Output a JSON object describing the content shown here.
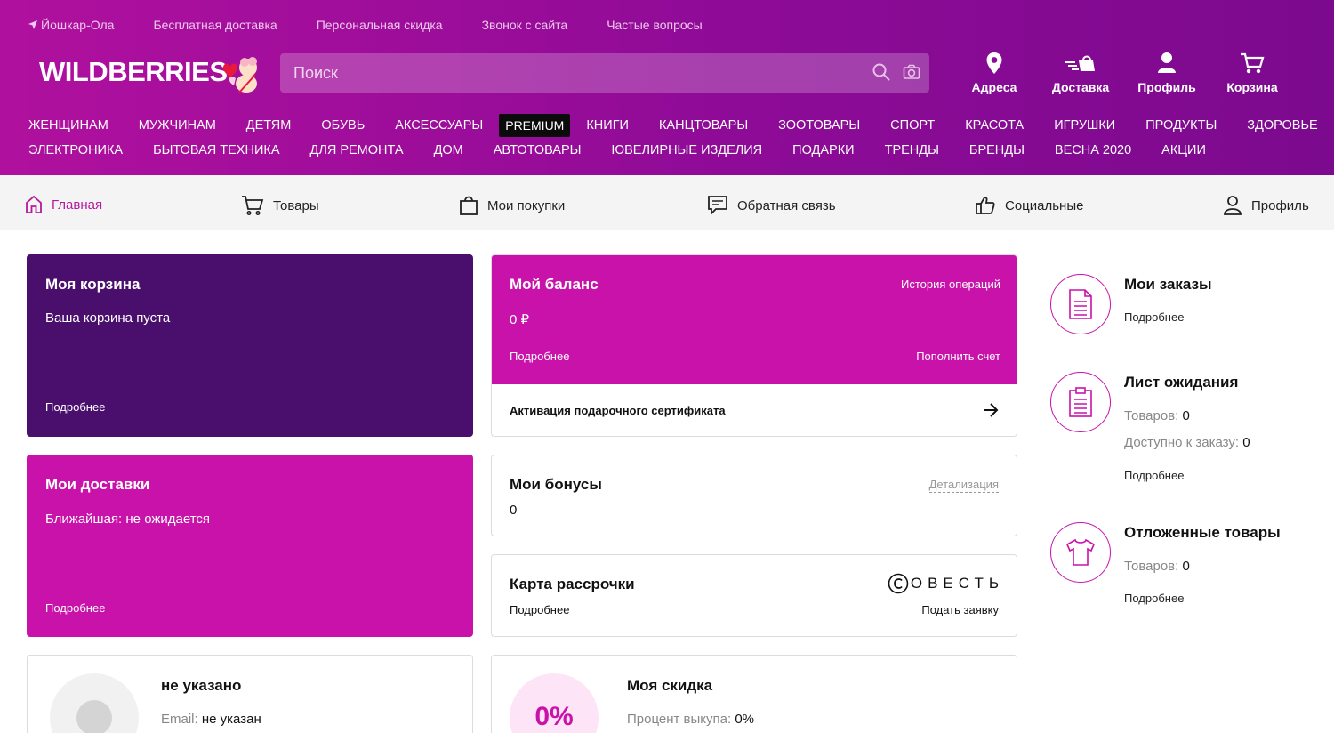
{
  "topbar": {
    "location": "Йошкар-Ола",
    "links": [
      "Бесплатная доставка",
      "Персональная скидка",
      "Звонок с сайта",
      "Частые вопросы"
    ]
  },
  "logo": {
    "text": "WILDBERRIES"
  },
  "search": {
    "placeholder": "Поиск"
  },
  "header_actions": [
    "Адреса",
    "Доставка",
    "Профиль",
    "Корзина"
  ],
  "categories": {
    "row1": [
      "ЖЕНЩИНАМ",
      "МУЖЧИНАМ",
      "ДЕТЯМ",
      "ОБУВЬ",
      "АКСЕССУАРЫ",
      "PREMIUM",
      "КНИГИ",
      "КАНЦТОВАРЫ",
      "ЗООТОВАРЫ",
      "СПОРТ",
      "КРАСОТА",
      "ИГРУШКИ",
      "ПРОДУКТЫ",
      "ЗДОРОВЬЕ"
    ],
    "row2": [
      "ЭЛЕКТРОНИКА",
      "БЫТОВАЯ ТЕХНИКА",
      "ДЛЯ РЕМОНТА",
      "ДОМ",
      "АВТОТОВАРЫ",
      "ЮВЕЛИРНЫЕ ИЗДЕЛИЯ",
      "ПОДАРКИ",
      "ТРЕНДЫ",
      "БРЕНДЫ",
      "ВЕСНА 2020",
      "АКЦИИ"
    ]
  },
  "subnav": [
    "Главная",
    "Товары",
    "Мои покупки",
    "Обратная связь",
    "Социальные",
    "Профиль"
  ],
  "cart": {
    "title": "Моя корзина",
    "text": "Ваша корзина пуста",
    "link": "Подробнее"
  },
  "deliveries": {
    "title": "Мои доставки",
    "text": "Ближайшая: не ожидается",
    "link": "Подробнее"
  },
  "profile": {
    "name": "не указано",
    "email_label": "Email:",
    "email_value": "не указан"
  },
  "balance": {
    "title": "Мой баланс",
    "history": "История операций",
    "amount": "0 ₽",
    "link": "Подробнее",
    "topup": "Пополнить счет",
    "certificate": "Активация подарочного сертификата"
  },
  "bonuses": {
    "title": "Мои бонусы",
    "details": "Детализация",
    "value": "0"
  },
  "installment": {
    "title": "Карта рассрочки",
    "brand": "ОВЕСТЬ",
    "link": "Подробнее",
    "apply": "Подать заявку"
  },
  "discount": {
    "title": "Моя скидка",
    "percent": "0%",
    "label": "Процент выкупа:",
    "value": "0%"
  },
  "orders": {
    "title": "Мои заказы",
    "link": "Подробнее"
  },
  "waitlist": {
    "title": "Лист ожидания",
    "goods_label": "Товаров:",
    "goods_value": "0",
    "avail_label": "Доступно к заказу:",
    "avail_value": "0",
    "link": "Подробнее"
  },
  "postponed": {
    "title": "Отложенные товары",
    "goods_label": "Товаров:",
    "goods_value": "0",
    "link": "Подробнее"
  },
  "colors": {
    "header": "#a00e9b",
    "accent": "#c912aa",
    "dark_purple": "#4a0f6c",
    "active_nav": "#b51a9e"
  }
}
